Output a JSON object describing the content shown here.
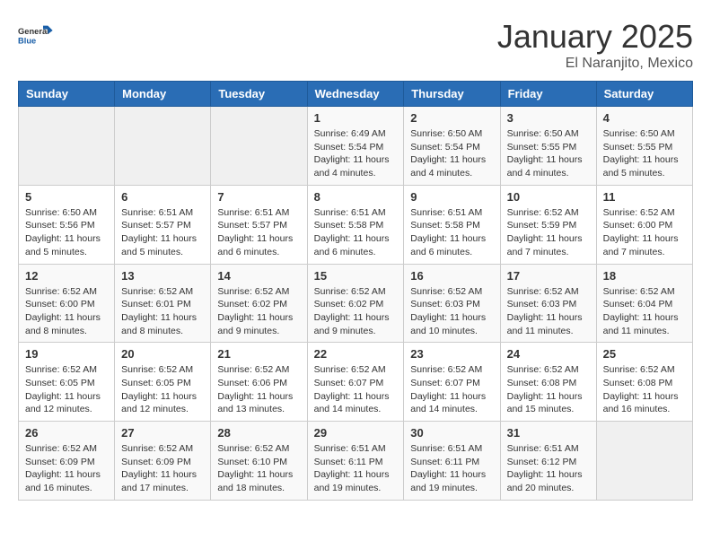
{
  "logo": {
    "general": "General",
    "blue": "Blue"
  },
  "title": {
    "month": "January 2025",
    "location": "El Naranjito, Mexico"
  },
  "headers": [
    "Sunday",
    "Monday",
    "Tuesday",
    "Wednesday",
    "Thursday",
    "Friday",
    "Saturday"
  ],
  "weeks": [
    [
      {
        "day": "",
        "sunrise": "",
        "sunset": "",
        "daylight": ""
      },
      {
        "day": "",
        "sunrise": "",
        "sunset": "",
        "daylight": ""
      },
      {
        "day": "",
        "sunrise": "",
        "sunset": "",
        "daylight": ""
      },
      {
        "day": "1",
        "sunrise": "Sunrise: 6:49 AM",
        "sunset": "Sunset: 5:54 PM",
        "daylight": "Daylight: 11 hours and 4 minutes."
      },
      {
        "day": "2",
        "sunrise": "Sunrise: 6:50 AM",
        "sunset": "Sunset: 5:54 PM",
        "daylight": "Daylight: 11 hours and 4 minutes."
      },
      {
        "day": "3",
        "sunrise": "Sunrise: 6:50 AM",
        "sunset": "Sunset: 5:55 PM",
        "daylight": "Daylight: 11 hours and 4 minutes."
      },
      {
        "day": "4",
        "sunrise": "Sunrise: 6:50 AM",
        "sunset": "Sunset: 5:55 PM",
        "daylight": "Daylight: 11 hours and 5 minutes."
      }
    ],
    [
      {
        "day": "5",
        "sunrise": "Sunrise: 6:50 AM",
        "sunset": "Sunset: 5:56 PM",
        "daylight": "Daylight: 11 hours and 5 minutes."
      },
      {
        "day": "6",
        "sunrise": "Sunrise: 6:51 AM",
        "sunset": "Sunset: 5:57 PM",
        "daylight": "Daylight: 11 hours and 5 minutes."
      },
      {
        "day": "7",
        "sunrise": "Sunrise: 6:51 AM",
        "sunset": "Sunset: 5:57 PM",
        "daylight": "Daylight: 11 hours and 6 minutes."
      },
      {
        "day": "8",
        "sunrise": "Sunrise: 6:51 AM",
        "sunset": "Sunset: 5:58 PM",
        "daylight": "Daylight: 11 hours and 6 minutes."
      },
      {
        "day": "9",
        "sunrise": "Sunrise: 6:51 AM",
        "sunset": "Sunset: 5:58 PM",
        "daylight": "Daylight: 11 hours and 6 minutes."
      },
      {
        "day": "10",
        "sunrise": "Sunrise: 6:52 AM",
        "sunset": "Sunset: 5:59 PM",
        "daylight": "Daylight: 11 hours and 7 minutes."
      },
      {
        "day": "11",
        "sunrise": "Sunrise: 6:52 AM",
        "sunset": "Sunset: 6:00 PM",
        "daylight": "Daylight: 11 hours and 7 minutes."
      }
    ],
    [
      {
        "day": "12",
        "sunrise": "Sunrise: 6:52 AM",
        "sunset": "Sunset: 6:00 PM",
        "daylight": "Daylight: 11 hours and 8 minutes."
      },
      {
        "day": "13",
        "sunrise": "Sunrise: 6:52 AM",
        "sunset": "Sunset: 6:01 PM",
        "daylight": "Daylight: 11 hours and 8 minutes."
      },
      {
        "day": "14",
        "sunrise": "Sunrise: 6:52 AM",
        "sunset": "Sunset: 6:02 PM",
        "daylight": "Daylight: 11 hours and 9 minutes."
      },
      {
        "day": "15",
        "sunrise": "Sunrise: 6:52 AM",
        "sunset": "Sunset: 6:02 PM",
        "daylight": "Daylight: 11 hours and 9 minutes."
      },
      {
        "day": "16",
        "sunrise": "Sunrise: 6:52 AM",
        "sunset": "Sunset: 6:03 PM",
        "daylight": "Daylight: 11 hours and 10 minutes."
      },
      {
        "day": "17",
        "sunrise": "Sunrise: 6:52 AM",
        "sunset": "Sunset: 6:03 PM",
        "daylight": "Daylight: 11 hours and 11 minutes."
      },
      {
        "day": "18",
        "sunrise": "Sunrise: 6:52 AM",
        "sunset": "Sunset: 6:04 PM",
        "daylight": "Daylight: 11 hours and 11 minutes."
      }
    ],
    [
      {
        "day": "19",
        "sunrise": "Sunrise: 6:52 AM",
        "sunset": "Sunset: 6:05 PM",
        "daylight": "Daylight: 11 hours and 12 minutes."
      },
      {
        "day": "20",
        "sunrise": "Sunrise: 6:52 AM",
        "sunset": "Sunset: 6:05 PM",
        "daylight": "Daylight: 11 hours and 12 minutes."
      },
      {
        "day": "21",
        "sunrise": "Sunrise: 6:52 AM",
        "sunset": "Sunset: 6:06 PM",
        "daylight": "Daylight: 11 hours and 13 minutes."
      },
      {
        "day": "22",
        "sunrise": "Sunrise: 6:52 AM",
        "sunset": "Sunset: 6:07 PM",
        "daylight": "Daylight: 11 hours and 14 minutes."
      },
      {
        "day": "23",
        "sunrise": "Sunrise: 6:52 AM",
        "sunset": "Sunset: 6:07 PM",
        "daylight": "Daylight: 11 hours and 14 minutes."
      },
      {
        "day": "24",
        "sunrise": "Sunrise: 6:52 AM",
        "sunset": "Sunset: 6:08 PM",
        "daylight": "Daylight: 11 hours and 15 minutes."
      },
      {
        "day": "25",
        "sunrise": "Sunrise: 6:52 AM",
        "sunset": "Sunset: 6:08 PM",
        "daylight": "Daylight: 11 hours and 16 minutes."
      }
    ],
    [
      {
        "day": "26",
        "sunrise": "Sunrise: 6:52 AM",
        "sunset": "Sunset: 6:09 PM",
        "daylight": "Daylight: 11 hours and 16 minutes."
      },
      {
        "day": "27",
        "sunrise": "Sunrise: 6:52 AM",
        "sunset": "Sunset: 6:09 PM",
        "daylight": "Daylight: 11 hours and 17 minutes."
      },
      {
        "day": "28",
        "sunrise": "Sunrise: 6:52 AM",
        "sunset": "Sunset: 6:10 PM",
        "daylight": "Daylight: 11 hours and 18 minutes."
      },
      {
        "day": "29",
        "sunrise": "Sunrise: 6:51 AM",
        "sunset": "Sunset: 6:11 PM",
        "daylight": "Daylight: 11 hours and 19 minutes."
      },
      {
        "day": "30",
        "sunrise": "Sunrise: 6:51 AM",
        "sunset": "Sunset: 6:11 PM",
        "daylight": "Daylight: 11 hours and 19 minutes."
      },
      {
        "day": "31",
        "sunrise": "Sunrise: 6:51 AM",
        "sunset": "Sunset: 6:12 PM",
        "daylight": "Daylight: 11 hours and 20 minutes."
      },
      {
        "day": "",
        "sunrise": "",
        "sunset": "",
        "daylight": ""
      }
    ]
  ]
}
